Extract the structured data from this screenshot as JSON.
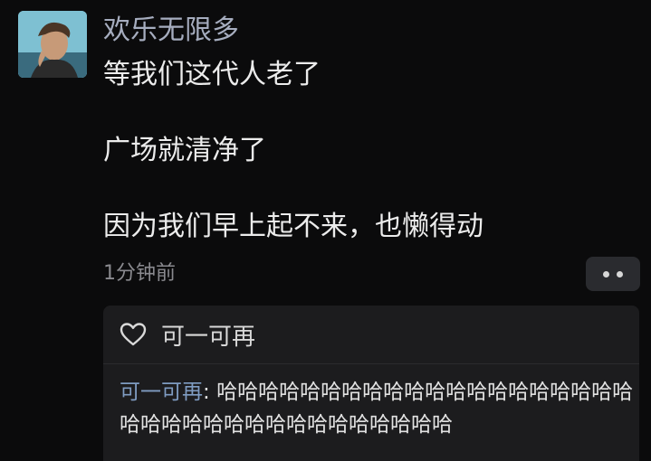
{
  "post": {
    "author": "欢乐无限多",
    "lines": [
      "等我们这代人老了",
      "广场就清净了",
      "因为我们早上起不来，也懒得动"
    ],
    "time": "1分钟前"
  },
  "icons": {
    "avatar": "user-avatar-portrait",
    "more": "more-dots-icon",
    "like": "heart-outline-icon"
  },
  "likes": {
    "user": "可一可再"
  },
  "reply": {
    "author": "可一可再",
    "separator": ": ",
    "text": "哈哈哈哈哈哈哈哈哈哈哈哈哈哈哈哈哈哈哈哈哈哈哈哈哈哈哈哈哈哈哈哈哈哈哈哈"
  },
  "colors": {
    "background": "#0b0b0c",
    "author_name": "#a6adbf",
    "reply_author": "#7f9cc2",
    "panel": "#1c1c1e"
  }
}
